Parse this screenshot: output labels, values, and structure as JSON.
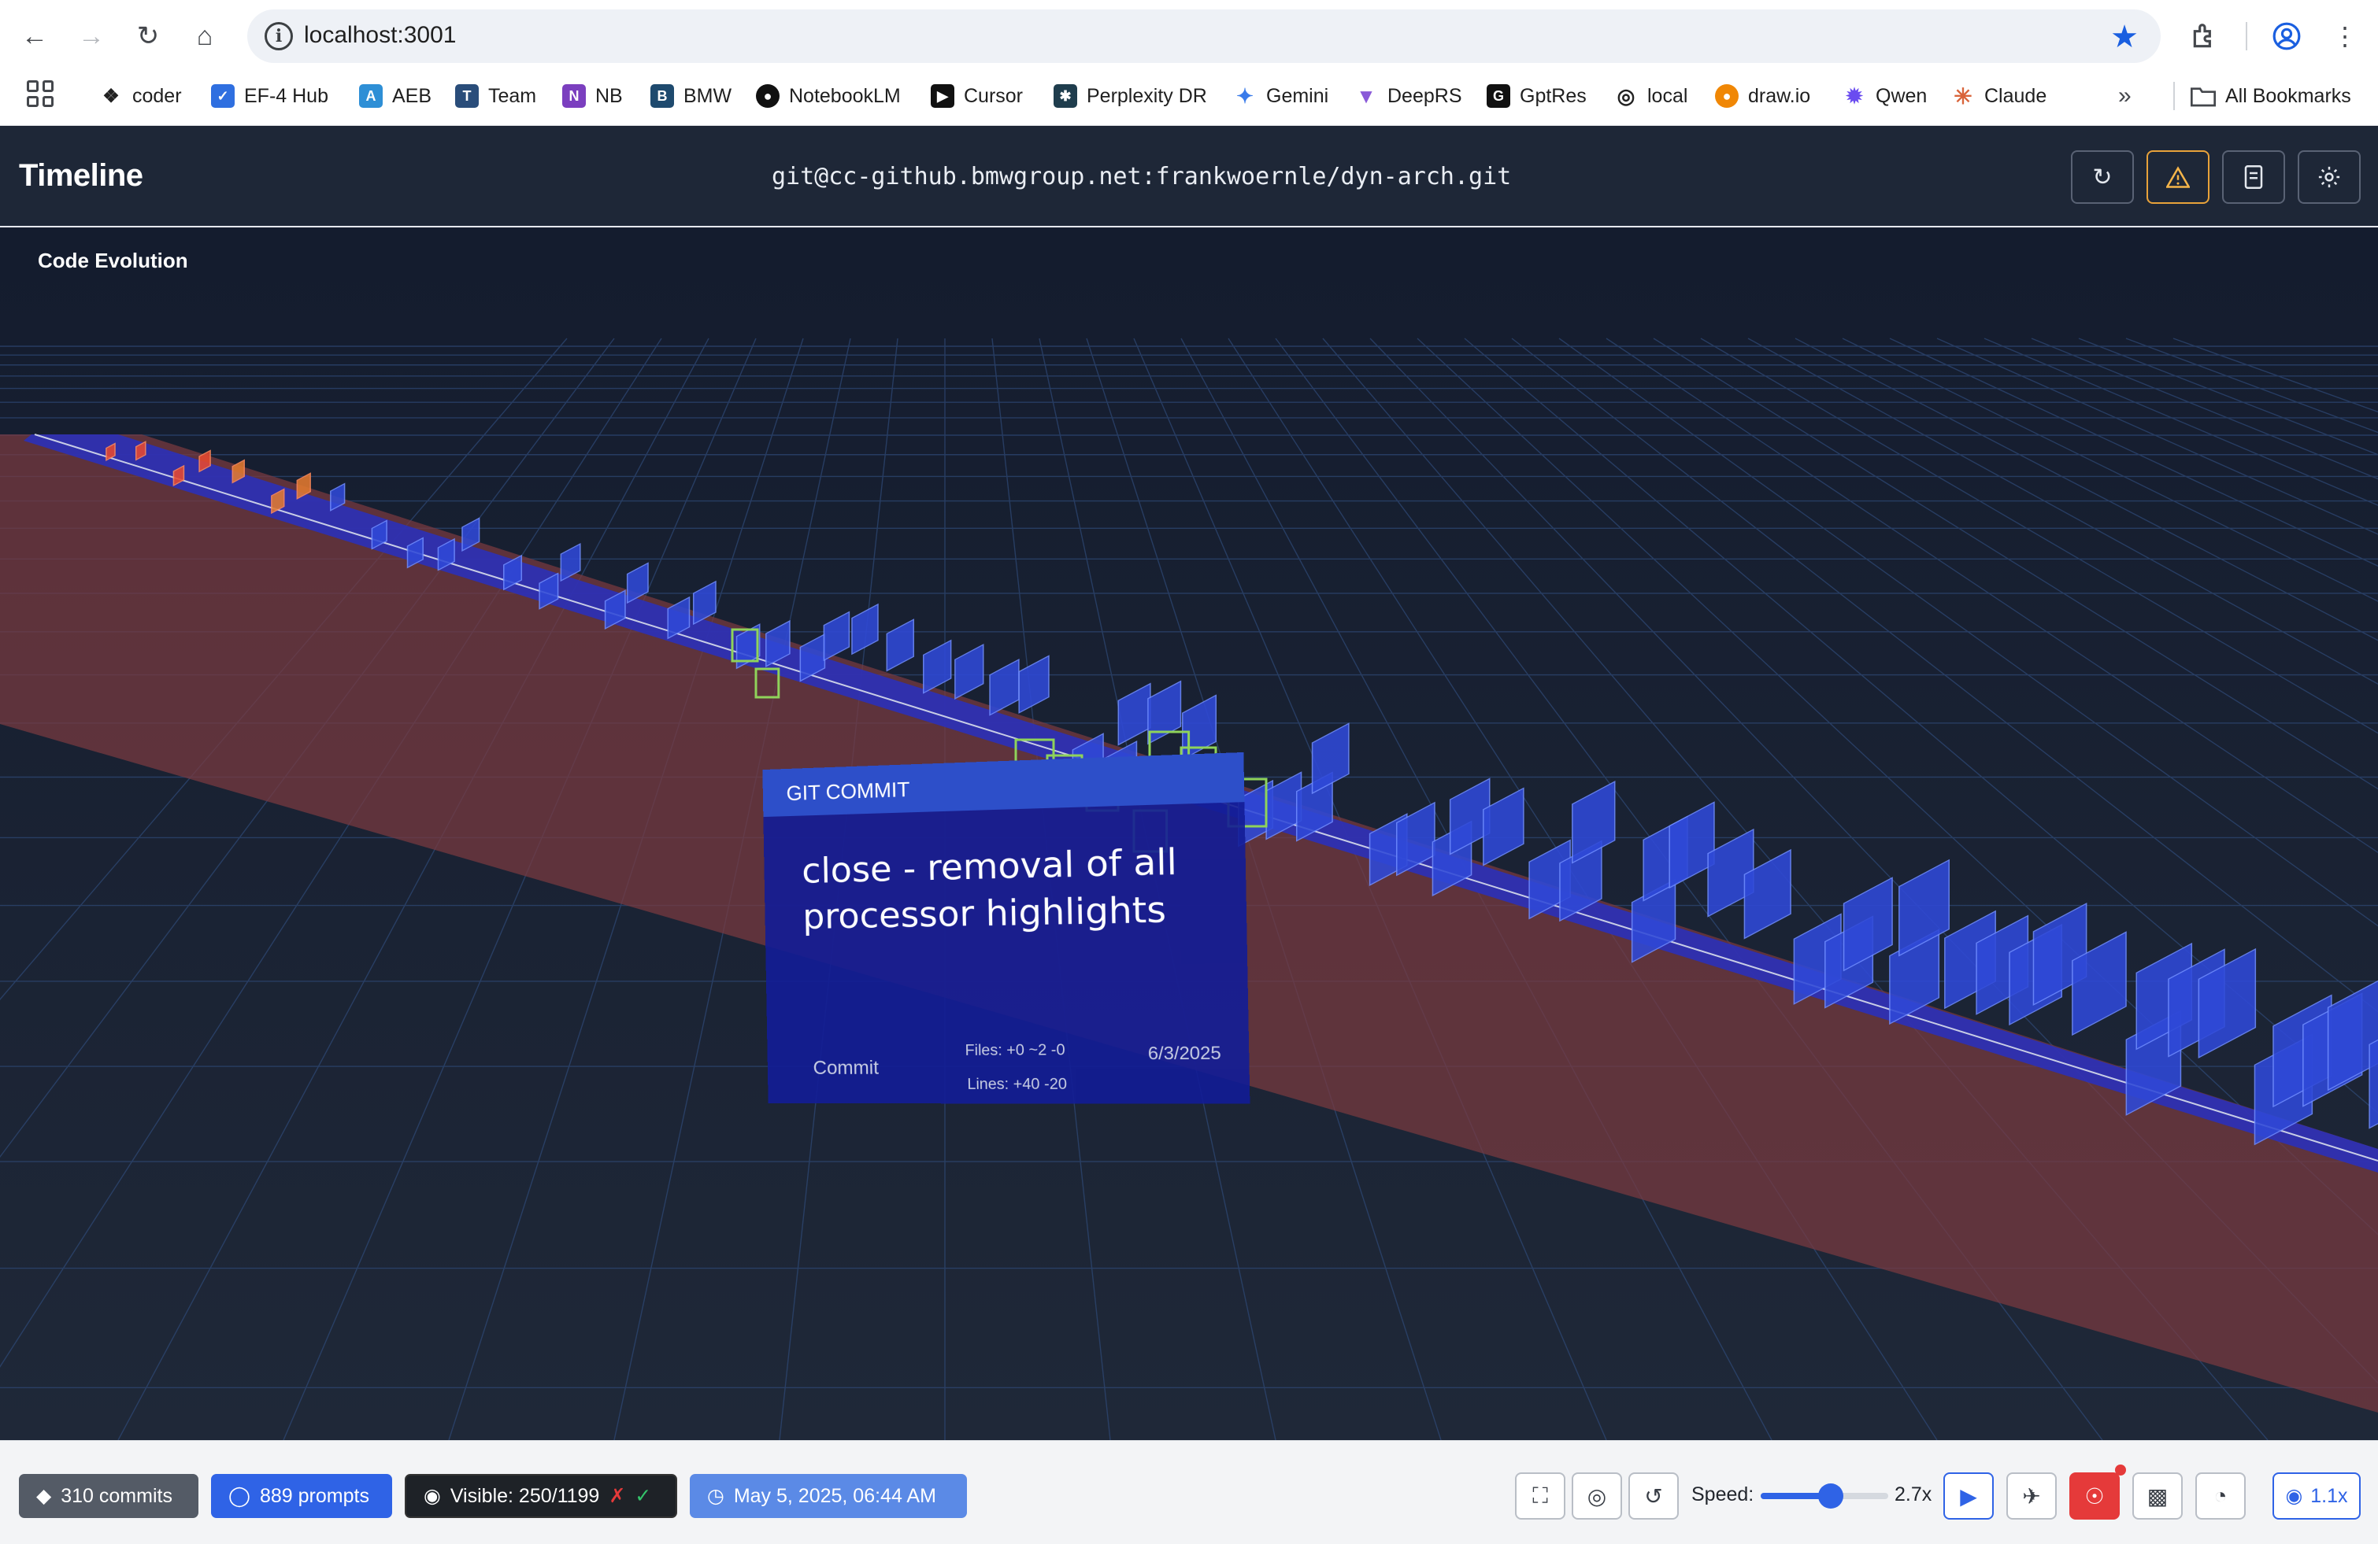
{
  "browser": {
    "url": "localhost:3001",
    "bookmarks": [
      "coder",
      "EF-4 Hub",
      "AEB",
      "Team",
      "NB",
      "BMW",
      "NotebookLM",
      "Cursor",
      "Perplexity DR",
      "Gemini",
      "DeepRS",
      "GptRes",
      "local",
      "draw.io",
      "Qwen",
      "Claude"
    ],
    "all_bookmarks": "All Bookmarks",
    "more": "»"
  },
  "header": {
    "title": "Timeline",
    "repo": "git@cc-github.bmwgroup.net:frankwoernle/dyn-arch.git"
  },
  "scene": {
    "title": "Code Evolution",
    "popup": {
      "header": "GIT COMMIT",
      "message": "close - removal of all processor highlights",
      "type": "Commit",
      "files": "Files: +0 ~2 -0",
      "lines": "Lines: +40 -20",
      "date": "6/3/2025"
    }
  },
  "footer": {
    "commits": "310 commits",
    "prompts": "889 prompts",
    "visible": "Visible: 250/1199",
    "date": "May 5, 2025, 06:44 AM",
    "speed_label": "Speed:",
    "speed_value": "2.7x",
    "speed_fraction": 0.55,
    "camera_label": "1.1x"
  },
  "colors": {
    "header_bg": "#1e2737",
    "accent_blue": "#2f63e6",
    "warning": "#f5b54a",
    "danger": "#e53a3a",
    "lane_red": "#7a3a40",
    "timeline_blue": "#2430c8"
  },
  "icons": {
    "back": "arrow-left-icon",
    "forward": "arrow-right-icon",
    "reload": "reload-icon",
    "home": "home-icon",
    "bookmark_star": "star-icon",
    "extensions": "puzzle-icon",
    "profile": "profile-icon",
    "menu": "kebab-menu-icon",
    "header_buttons": [
      "refresh-icon",
      "warning-icon",
      "document-icon",
      "settings-icon"
    ],
    "footer_controls": [
      "fullscreen-icon",
      "target-icon",
      "reset-icon",
      "play-icon",
      "airplane-icon",
      "bug-icon",
      "video-camera-icon",
      "gauge-icon",
      "camera-icon"
    ]
  }
}
